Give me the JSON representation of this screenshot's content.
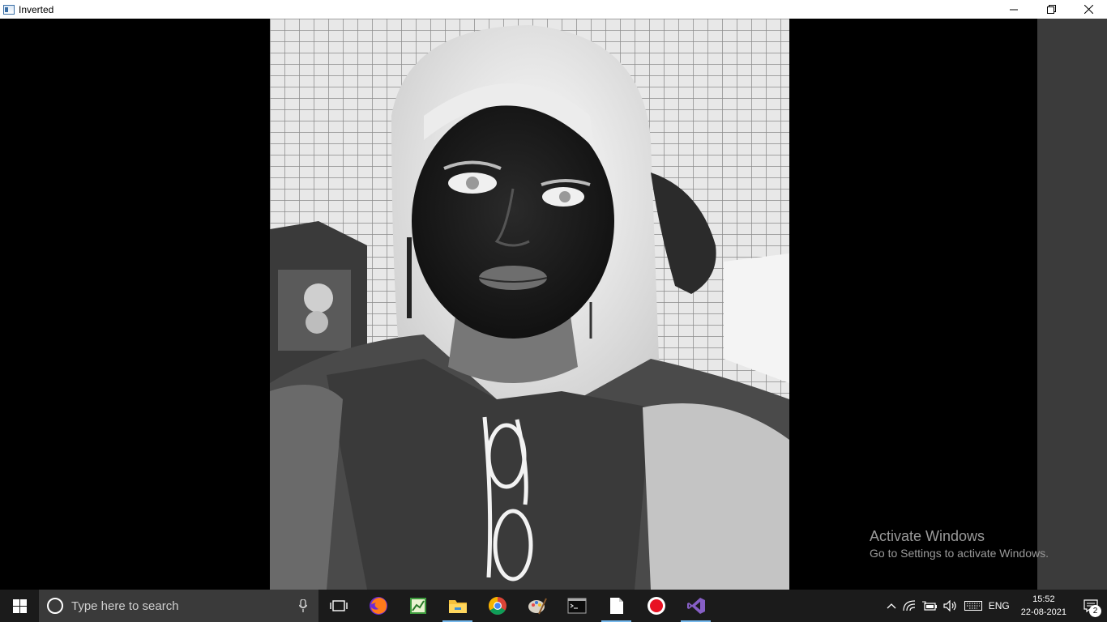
{
  "window": {
    "title": "Inverted",
    "minimize_glyph": "—",
    "maximize_glyph": "❐",
    "close_glyph": "✕"
  },
  "watermark": {
    "line1": "Activate Windows",
    "line2": "Go to Settings to activate Windows."
  },
  "taskbar": {
    "search_placeholder": "Type here to search",
    "apps": [
      {
        "icon": "task-view-icon"
      },
      {
        "icon": "firefox-icon"
      },
      {
        "icon": "chart-app-icon"
      },
      {
        "icon": "file-explorer-icon"
      },
      {
        "icon": "chrome-icon"
      },
      {
        "icon": "paint-icon"
      },
      {
        "icon": "terminal-icon"
      },
      {
        "icon": "notepad-icon"
      },
      {
        "icon": "record-icon"
      },
      {
        "icon": "visual-studio-icon"
      }
    ],
    "tray": {
      "language": "ENG",
      "time": "15:52",
      "date": "22-08-2021",
      "notification_count": "2"
    }
  },
  "colors": {
    "taskbar_bg": "#1b1b1b",
    "accent": "#76b9ed",
    "record_red": "#e81123",
    "vs_purple": "#865fc5"
  }
}
